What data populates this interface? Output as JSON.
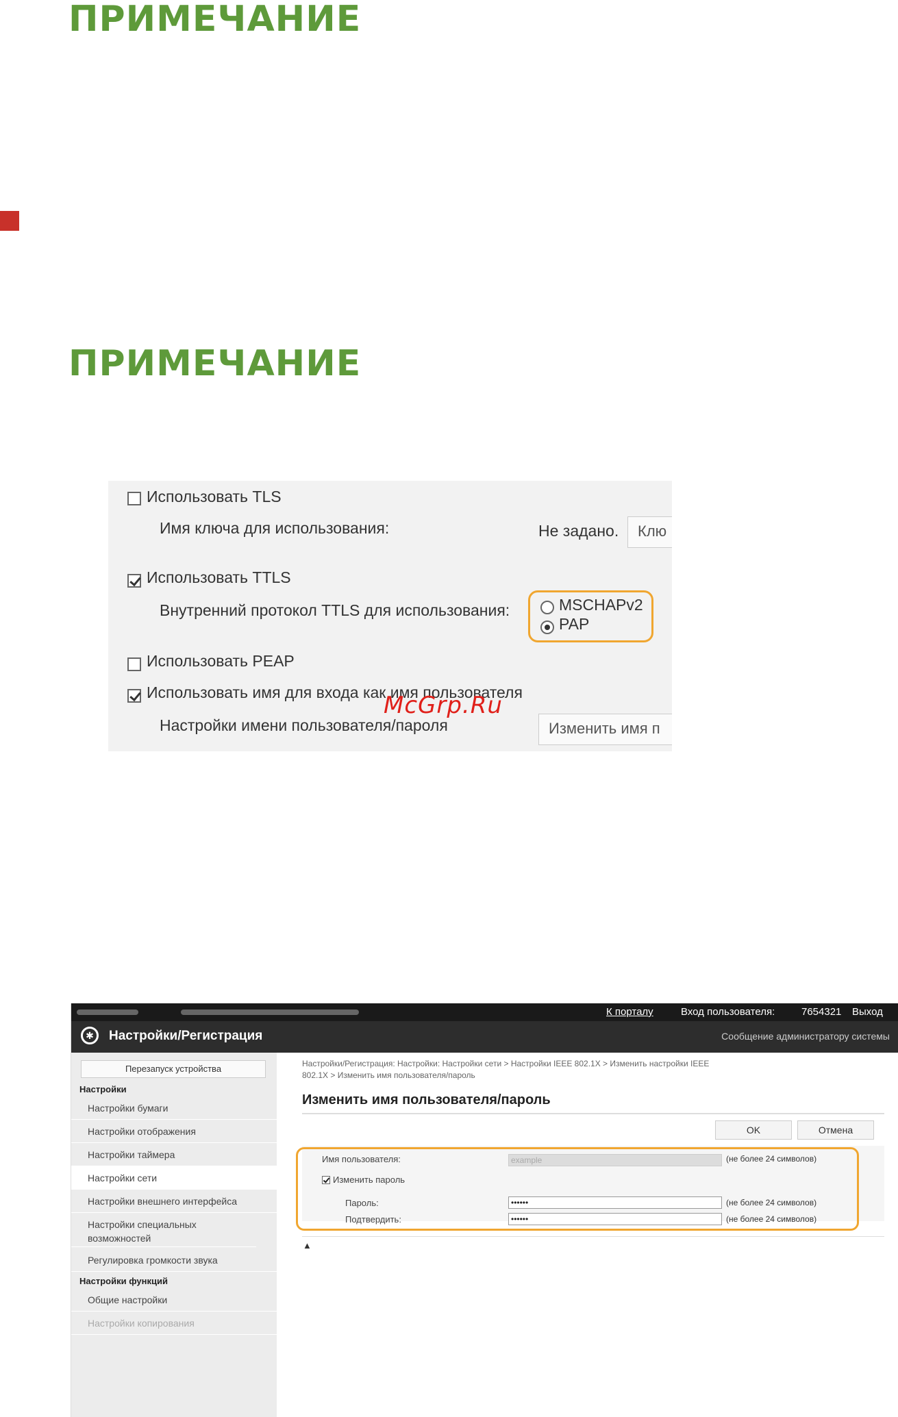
{
  "notes": {
    "heading_1": "ПРИМЕЧАНИЕ",
    "heading_2": "ПРИМЕЧАНИЕ"
  },
  "watermark": "McGrp.Ru",
  "screenshot1": {
    "use_tls": {
      "label": "Использовать TLS",
      "checked": false
    },
    "key_name_label": "Имя ключа для использования:",
    "key_name_value": "Не задано.",
    "key_button": "Клю",
    "use_ttls": {
      "label": "Использовать TTLS",
      "checked": true
    },
    "inner_protocol_label": "Внутренний протокол TTLS для использования:",
    "inner_protocol_options": [
      {
        "label": "MSCHAPv2",
        "selected": false
      },
      {
        "label": "PAP",
        "selected": true
      }
    ],
    "use_peap": {
      "label": "Использовать PEAP",
      "checked": false
    },
    "use_login_name": {
      "label": "Использовать имя для входа как имя пользователя",
      "checked": true
    },
    "user_pass_settings_label": "Настройки имени пользователя/пароля",
    "change_button": "Изменить имя п",
    "highlight_color": "#f0a630"
  },
  "screenshot2": {
    "topbar": {
      "portal_link": "К порталу",
      "login_user_label": "Вход пользователя:",
      "login_user_value": "7654321",
      "logout_link": "Выход"
    },
    "header": {
      "title": "Настройки/Регистрация",
      "admin_message_link": "Сообщение администратору системы"
    },
    "sidebar": {
      "restart_button": "Перезапуск устройства",
      "section_settings": "Настройки",
      "items": [
        {
          "label": "Настройки бумаги"
        },
        {
          "label": "Настройки отображения"
        },
        {
          "label": "Настройки таймера"
        },
        {
          "label": "Настройки сети"
        },
        {
          "label": "Настройки внешнего интерфейса"
        },
        {
          "label": "Настройки специальных возможностей"
        },
        {
          "label": "Регулировка громкости звука"
        }
      ],
      "section_functions": "Настройки функций",
      "function_items": [
        {
          "label": "Общие настройки"
        },
        {
          "label": "Настройки копирования"
        }
      ]
    },
    "main": {
      "breadcrumb": "Настройки/Регистрация: Настройки: Настройки сети > Настройки IEEE 802.1X > Изменить настройки IEEE 802.1X > Изменить имя пользователя/пароль",
      "title": "Изменить имя пользователя/пароль",
      "ok_button": "OK",
      "cancel_button": "Отмена",
      "username_label": "Имя пользователя:",
      "username_value": "example",
      "username_hint": "(не более 24 символов)",
      "change_password": {
        "label": "Изменить пароль",
        "checked": true
      },
      "password_label": "Пароль:",
      "password_value": "••••••",
      "password_hint": "(не более 24 символов)",
      "confirm_label": "Подтвердить:",
      "confirm_value": "••••••",
      "confirm_hint": "(не более 24 символов)",
      "top_icon": "top-of-page-icon"
    },
    "colors": {
      "topbar": "#1a1a1a",
      "header": "#2d2d2d",
      "highlight": "#f0a630"
    }
  }
}
